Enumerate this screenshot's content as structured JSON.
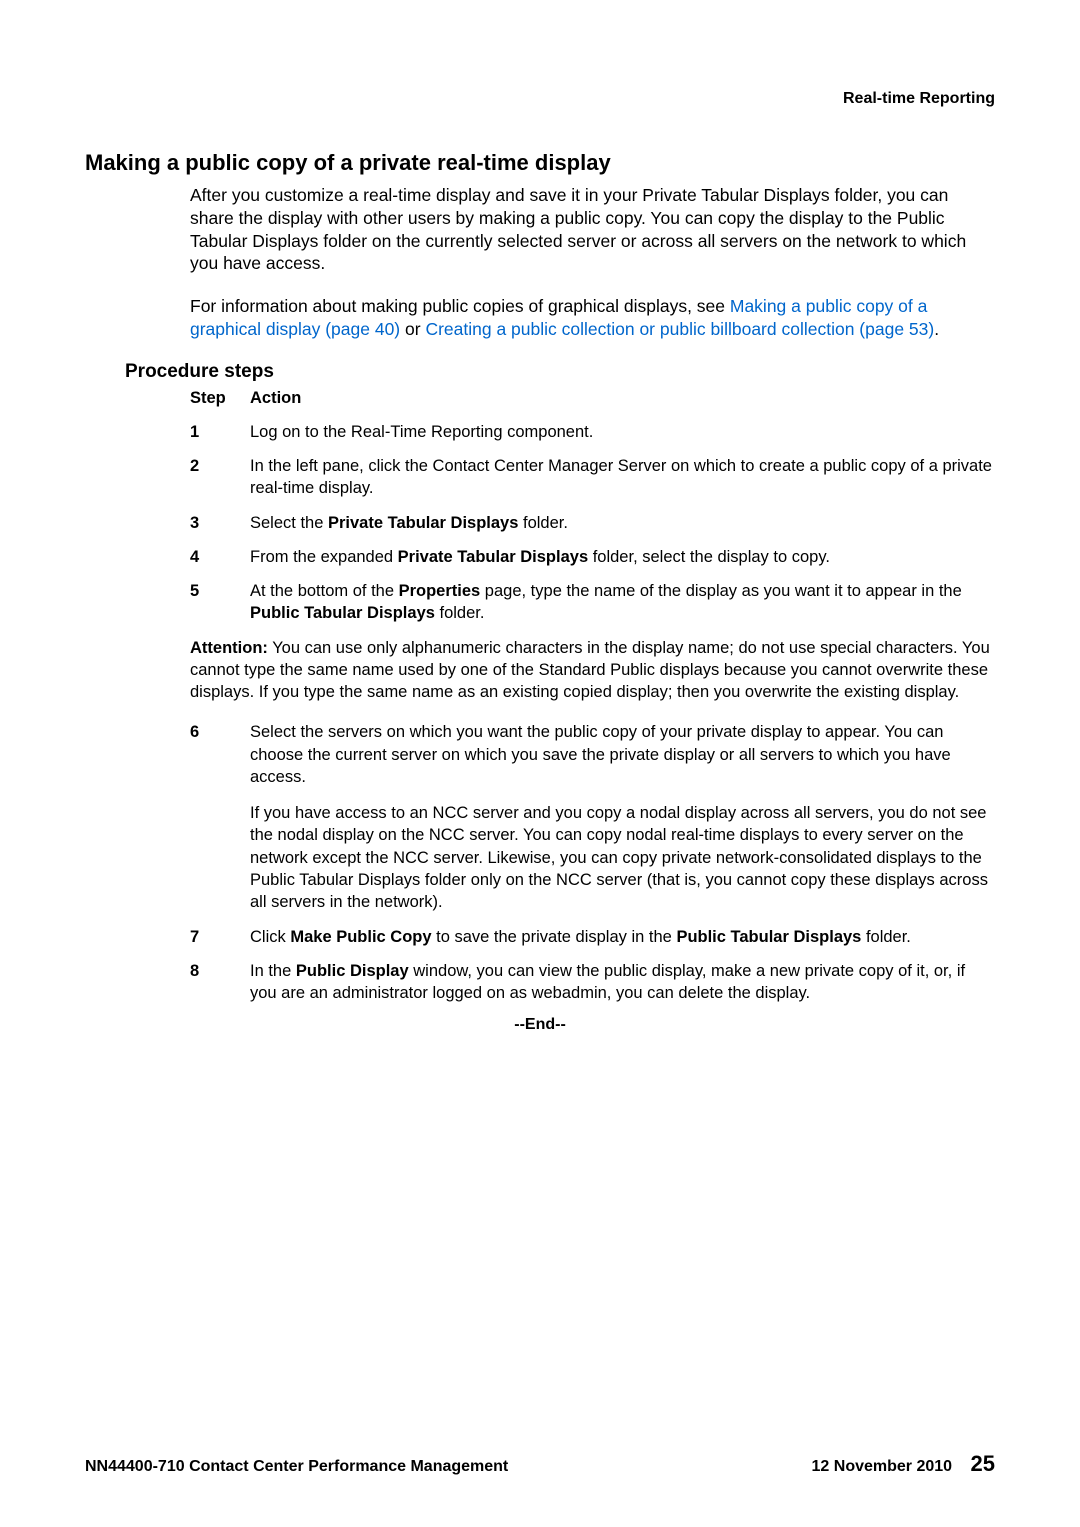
{
  "header": {
    "right": "Real-time Reporting"
  },
  "section": {
    "title": "Making a public copy of a private real-time display",
    "intro1": "After you customize a real-time display and save it in your Private Tabular Displays folder, you can share the display with other users by making a public copy. You can copy the display to the Public Tabular Displays folder on the currently selected server or across all servers on the network to which you have access.",
    "intro2_pre": "For information about making public copies of graphical displays, see ",
    "intro2_link1": "Making a public copy of a graphical display (page 40)",
    "intro2_mid": " or ",
    "intro2_link2": "Creating a public collection or public billboard collection (page 53)",
    "intro2_post": "."
  },
  "procedure": {
    "title": "Procedure steps",
    "step_label": "Step",
    "action_label": "Action",
    "steps": {
      "s1": "Log on to the Real-Time Reporting component.",
      "s2": "In the left pane, click the Contact Center Manager Server on which to create a public copy of a private real-time display.",
      "s3_pre": "Select the ",
      "s3_b": "Private Tabular Displays",
      "s3_post": " folder.",
      "s4_pre": "From the expanded ",
      "s4_b": "Private Tabular Displays",
      "s4_post": " folder, select the display to copy.",
      "s5_pre": "At the bottom of the ",
      "s5_b1": "Properties",
      "s5_mid": " page, type the name of the display as you want it to appear in the ",
      "s5_b2": "Public Tabular Displays",
      "s5_post": " folder.",
      "attention_label": "Attention:",
      "attention_text": "  You can use only alphanumeric characters in the display name; do not use special characters. You cannot type the same name used by one of the Standard Public displays because you cannot overwrite these displays. If you type the same name as an existing copied display; then you overwrite the existing display.",
      "s6a": "Select the servers on which you want the public copy of your private display to appear. You can choose the current server on which you save the private display or all servers to which you have access.",
      "s6b": "If you have access to an NCC server and you copy a nodal display across all servers, you do not see the nodal display on the NCC server. You can copy nodal real-time displays to every server on the network except the NCC server. Likewise, you can copy private network-consolidated displays to the Public Tabular Displays folder only on the NCC server (that is, you cannot copy these displays across all servers in the network).",
      "s7_pre": "Click ",
      "s7_b1": "Make Public Copy",
      "s7_mid": " to save the private display in the ",
      "s7_b2": "Public Tabular Displays",
      "s7_post": " folder.",
      "s8_pre": "In the ",
      "s8_b": "Public Display",
      "s8_post": " window, you can view the public display, make a new private copy of it, or, if you are an administrator logged on as webadmin, you can delete the display."
    },
    "end": "--End--"
  },
  "footer": {
    "left": "NN44400-710 Contact Center Performance Management",
    "date": "12 November 2010",
    "page": "25"
  }
}
